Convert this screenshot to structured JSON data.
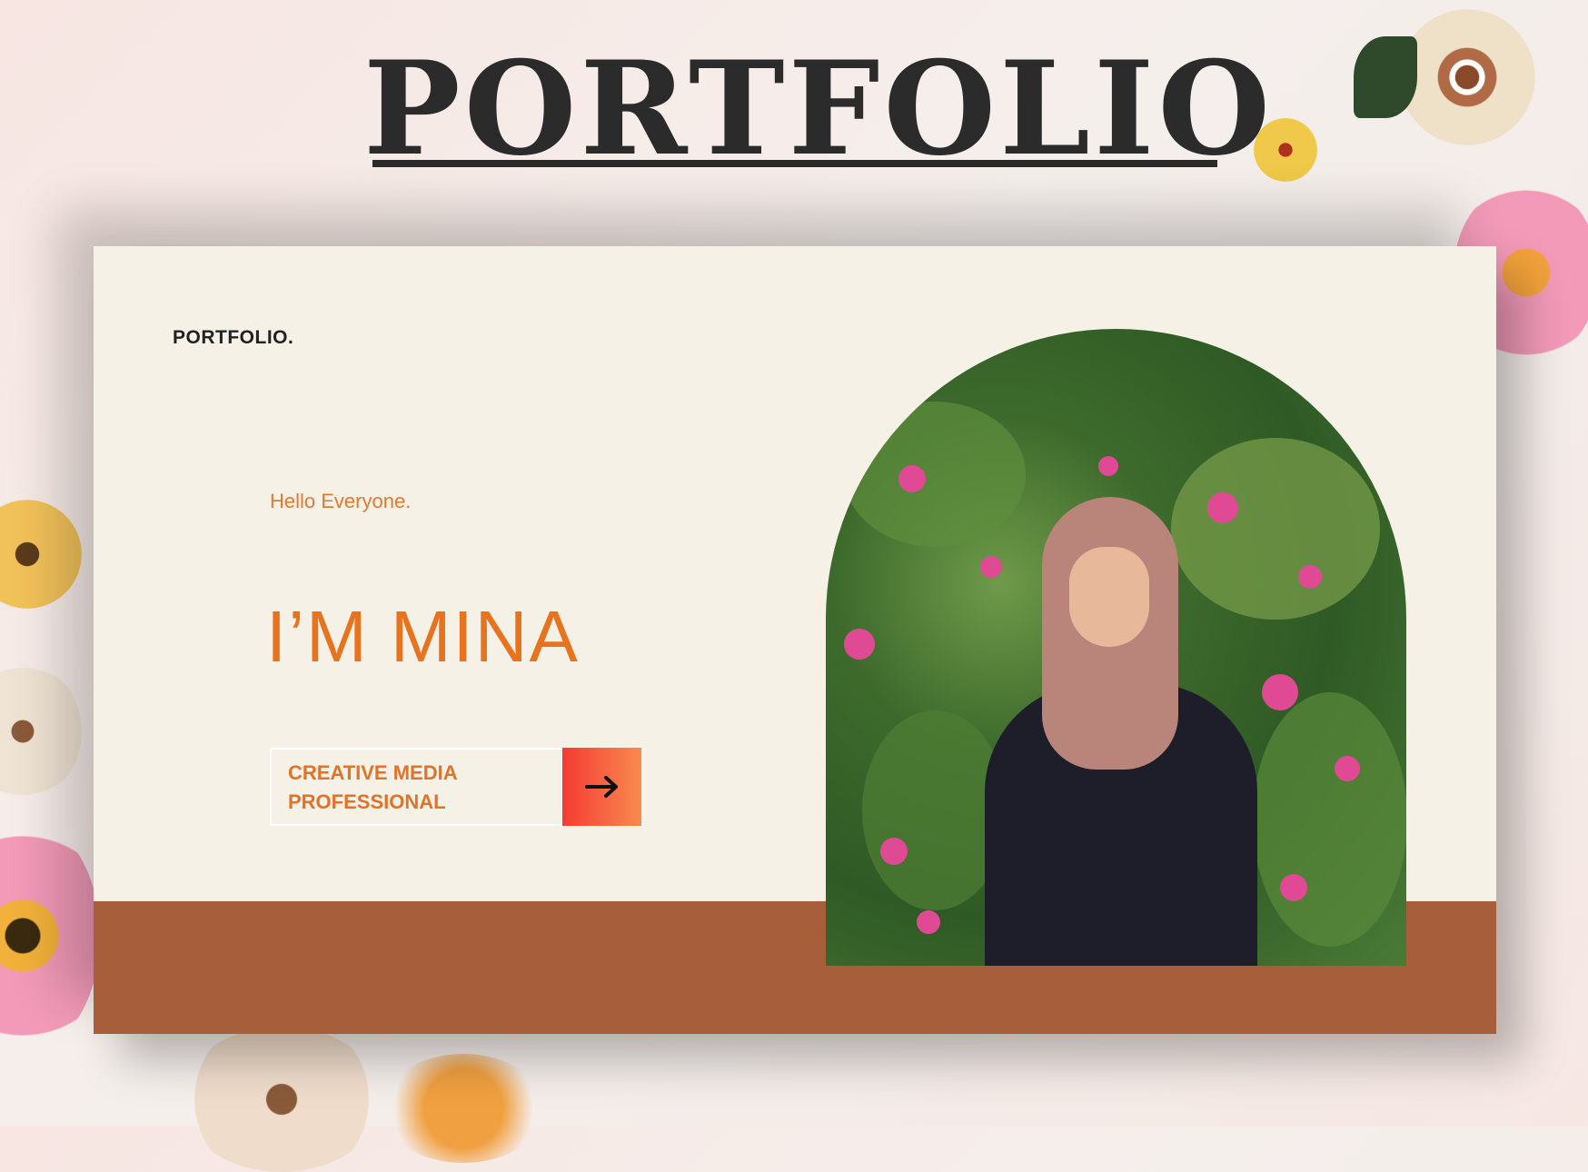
{
  "header": {
    "title": "PORTFOLIO"
  },
  "slide": {
    "brand": "PORTFOLIO.",
    "greeting": "Hello Everyone.",
    "name": "I’M MINA",
    "cta": {
      "line1": "CREATIVE MEDIA",
      "line2": "PROFESSIONAL",
      "icon": "arrow-right-icon"
    },
    "photo_alt": "portrait-photo"
  },
  "colors": {
    "accent": "#e8731f",
    "band": "#a65f3a",
    "card": "#f5f1e7",
    "title": "#2b2b2b"
  }
}
